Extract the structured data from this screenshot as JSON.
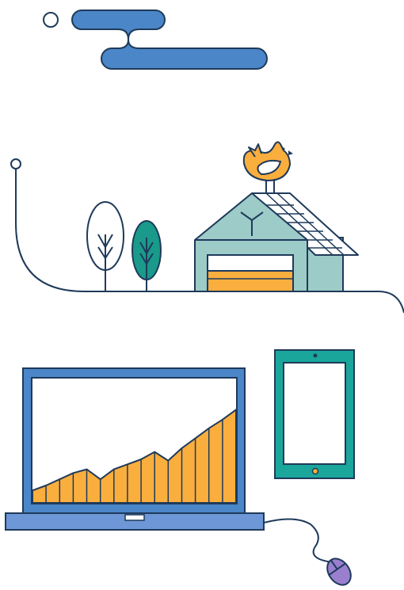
{
  "colors": {
    "outline": "#1f3a5a",
    "cloud_blue": "#4a86c8",
    "garage_teal": "#9dcbc8",
    "tree_teal": "#1a9a8a",
    "chart_orange": "#f9ae3e",
    "tablet_teal": "#1aa69a",
    "laptop_base_blue": "#6d97d6",
    "mouse_purple": "#9a7fce",
    "white": "#ffffff"
  },
  "icons": [
    "cloud-icon",
    "small-circle-icon",
    "tree-outline-icon",
    "tree-teal-icon",
    "garage-house-icon",
    "rooster-icon",
    "laptop-icon",
    "area-chart-icon",
    "tablet-icon",
    "mouse-icon"
  ],
  "chart_data": {
    "type": "area",
    "x": [
      0,
      1,
      2,
      3,
      4,
      5,
      6,
      7,
      8,
      9,
      10,
      11,
      12,
      13,
      14,
      15
    ],
    "values": [
      10,
      14,
      19,
      24,
      27,
      19,
      27,
      31,
      35,
      41,
      34,
      44,
      52,
      60,
      67,
      75
    ]
  }
}
